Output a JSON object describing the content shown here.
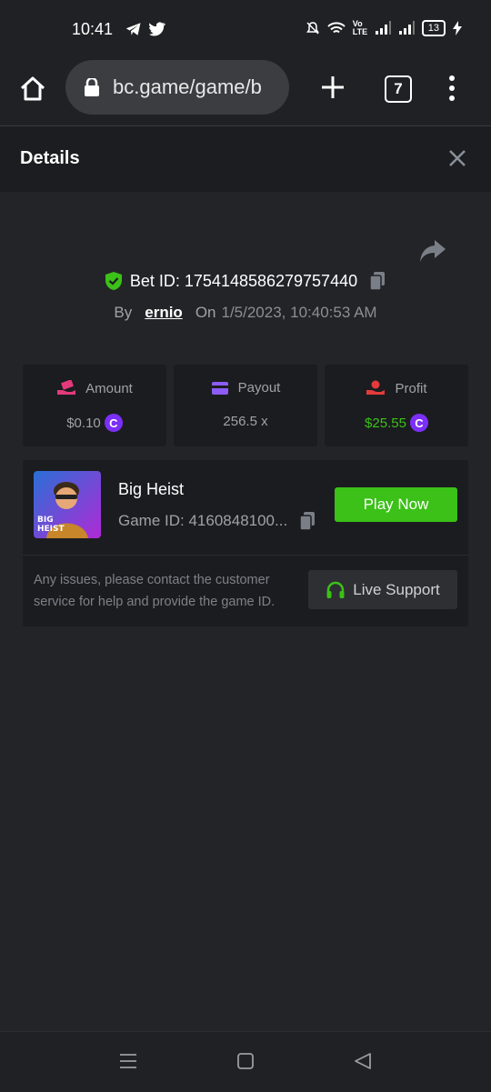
{
  "status_bar": {
    "time": "10:41",
    "left_icons": [
      "telegram-icon",
      "twitter-icon"
    ],
    "right_icons": [
      "mute-icon",
      "wifi-icon",
      "volte-icon",
      "signal-icon",
      "signal-icon",
      "battery-icon",
      "charging-icon"
    ],
    "volte_label": "Vo\nLTE",
    "battery": "13"
  },
  "browser": {
    "url": "bc.game/game/b",
    "tab_count": "7"
  },
  "details": {
    "title": "Details",
    "bet_id_label": "Bet ID: 1754148586279757440",
    "by_label": "By",
    "username": "ernio",
    "on_label": "On",
    "date": "1/5/2023, 10:40:53 AM"
  },
  "stats": [
    {
      "label": "Amount",
      "value": "$0.10",
      "icon": "money-hand-icon",
      "color": "#e23a7c"
    },
    {
      "label": "Payout",
      "value": "256.5 x",
      "icon": "card-icon",
      "color": "#8b5cf6"
    },
    {
      "label": "Profit",
      "value": "$25.55",
      "icon": "profit-icon",
      "color": "#e33b3b"
    }
  ],
  "coin_symbol": "C",
  "game": {
    "name": "Big Heist",
    "game_id": "Game ID: 4160848100...",
    "thumb_text": "BIG HEIST",
    "play_label": "Play Now",
    "support_text": "Any issues, please contact the customer service for help and provide the game ID.",
    "live_support_label": "Live Support"
  },
  "colors": {
    "accent_green": "#3bc117",
    "background": "#232428",
    "card": "#1b1c1f"
  }
}
